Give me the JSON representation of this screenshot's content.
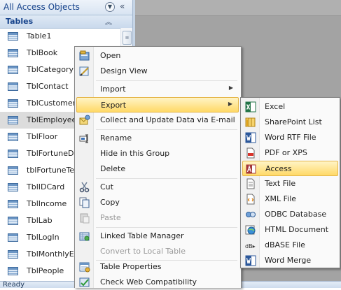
{
  "nav_pane": {
    "title": "All Access Objects",
    "group_label": "Tables",
    "items": [
      {
        "label": "Table1"
      },
      {
        "label": "TblBook"
      },
      {
        "label": "TblCategory"
      },
      {
        "label": "TblContact"
      },
      {
        "label": "TblCustomer"
      },
      {
        "label": "TblEmployee",
        "selected": true
      },
      {
        "label": "TblFloor"
      },
      {
        "label": "TblFortuneDa"
      },
      {
        "label": "tblFortuneTel"
      },
      {
        "label": "TblIDCard"
      },
      {
        "label": "TblIncome"
      },
      {
        "label": "TblLab"
      },
      {
        "label": "TblLogIn"
      },
      {
        "label": "TblMonthlyEa"
      },
      {
        "label": "TblPeople"
      }
    ]
  },
  "status_bar": {
    "text": "Ready"
  },
  "context_menu": {
    "open": "Open",
    "design_view": "Design View",
    "import": "Import",
    "export": "Export",
    "collect_data": "Collect and Update Data via E-mail",
    "rename": "Rename",
    "hide_in_group": "Hide in this Group",
    "delete": "Delete",
    "cut": "Cut",
    "copy": "Copy",
    "paste": "Paste",
    "linked_table_manager": "Linked Table Manager",
    "convert_to_local": "Convert to Local Table",
    "table_properties": "Table Properties",
    "check_web_compat": "Check Web Compatibility"
  },
  "export_menu": {
    "excel": "Excel",
    "sharepoint_list": "SharePoint List",
    "word_rtf": "Word RTF File",
    "pdf_xps": "PDF or XPS",
    "access": "Access",
    "text_file": "Text File",
    "xml_file": "XML File",
    "odbc": "ODBC Database",
    "html_document": "HTML Document",
    "dbase_file": "dBASE File",
    "word_merge": "Word Merge"
  },
  "colors": {
    "highlight_top": "#fff4c6",
    "highlight_bottom": "#ffd967",
    "nav_title": "#15428b",
    "selected_row": "#dcdcdc"
  }
}
